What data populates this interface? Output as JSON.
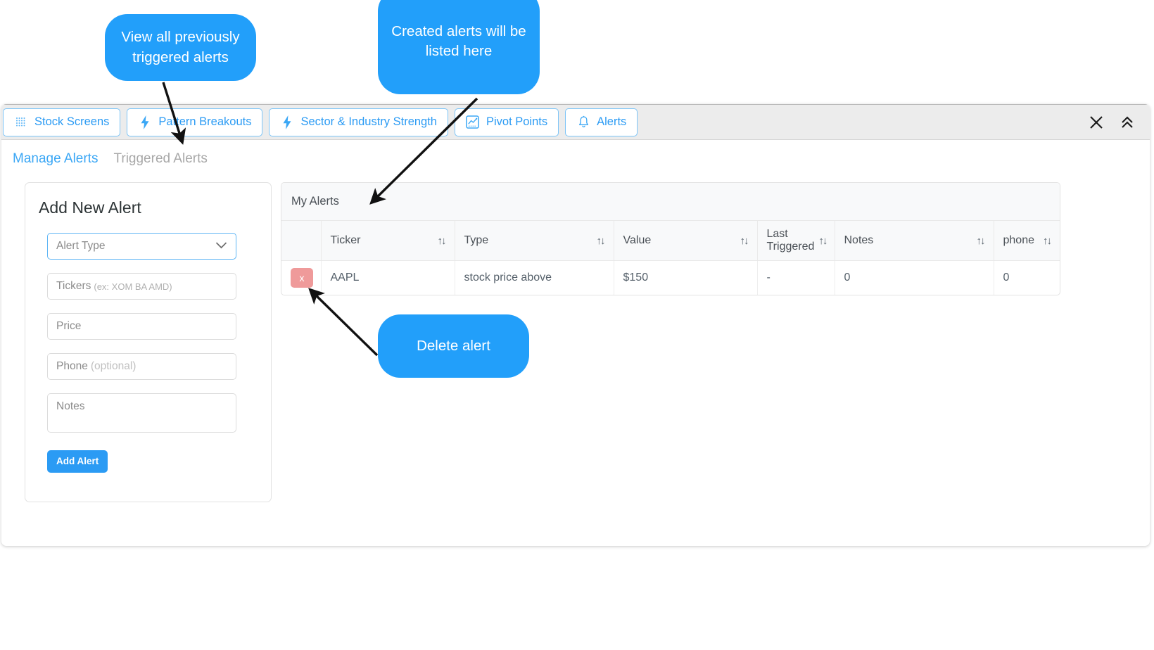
{
  "window": {
    "tabs": [
      {
        "id": "stock-screens",
        "label": "Stock Screens",
        "icon": "dot-grid-icon"
      },
      {
        "id": "pattern-breakouts",
        "label": "Pattern Breakouts",
        "icon": "lightning-bolt-icon"
      },
      {
        "id": "sector-industry-strength",
        "label": "Sector & Industry Strength",
        "icon": "lightning-bolt-icon"
      },
      {
        "id": "pivot-points",
        "label": "Pivot Points",
        "icon": "chart-box-icon"
      },
      {
        "id": "alerts",
        "label": "Alerts",
        "icon": "bell-icon"
      }
    ],
    "controls": {
      "close": "close-icon",
      "collapse": "double-chevron-up-icon"
    }
  },
  "subtabs": [
    {
      "id": "manage-alerts",
      "label": "Manage Alerts",
      "active": true
    },
    {
      "id": "triggered-alerts",
      "label": "Triggered Alerts",
      "active": false
    }
  ],
  "add_alert": {
    "title": "Add New Alert",
    "alert_type": {
      "placeholder": "Alert Type",
      "value": ""
    },
    "tickers": {
      "placeholder": "Tickers",
      "hint": "(ex: XOM BA AMD)",
      "value": ""
    },
    "price": {
      "placeholder": "Price",
      "value": ""
    },
    "phone": {
      "placeholder": "Phone",
      "hint": "(optional)",
      "value": ""
    },
    "notes": {
      "placeholder": "Notes",
      "value": ""
    },
    "submit_label": "Add Alert"
  },
  "alerts_table": {
    "title": "My Alerts",
    "columns": [
      {
        "key": "delete",
        "label": "",
        "sortable": false
      },
      {
        "key": "ticker",
        "label": "Ticker",
        "sortable": true
      },
      {
        "key": "type",
        "label": "Type",
        "sortable": true
      },
      {
        "key": "value",
        "label": "Value",
        "sortable": true
      },
      {
        "key": "last_triggered",
        "label": "Last Triggered",
        "sortable": true
      },
      {
        "key": "notes",
        "label": "Notes",
        "sortable": true
      },
      {
        "key": "phone",
        "label": "phone",
        "sortable": true
      }
    ],
    "sort_glyph": "↑↓",
    "delete_glyph": "x",
    "rows": [
      {
        "ticker": "AAPL",
        "type": "stock price above",
        "value": "$150",
        "last_triggered": "-",
        "notes": "0",
        "phone": "0"
      }
    ]
  },
  "callouts": [
    {
      "id": "triggered",
      "text": "View all previously triggered alerts"
    },
    {
      "id": "created",
      "text": "Created alerts will be listed here"
    },
    {
      "id": "delete",
      "text": "Delete alert"
    }
  ],
  "colors": {
    "accent_blue": "#229ffa",
    "tab_blue": "#2b9bf4",
    "delete_red": "#ef9a9a",
    "tabbar_gray": "#ececec",
    "header_gray": "#f8f9fa"
  }
}
